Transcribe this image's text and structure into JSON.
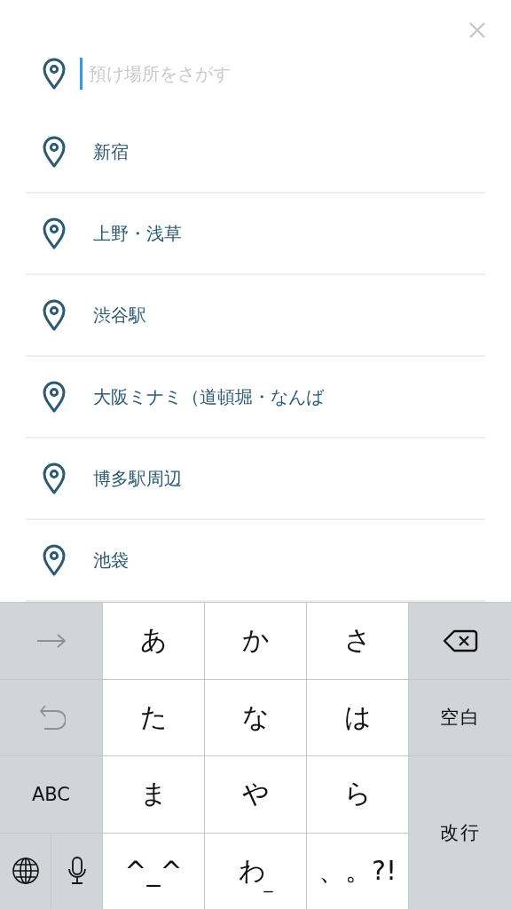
{
  "search": {
    "placeholder": "預け場所をさがす",
    "focused": true
  },
  "places": [
    {
      "name": "新宿"
    },
    {
      "name": "上野・浅草"
    },
    {
      "name": "渋谷駅"
    },
    {
      "name": "大阪ミナミ（道頓堀・なんば"
    },
    {
      "name": "博多駅周辺"
    },
    {
      "name": "池袋"
    }
  ],
  "keyboard": {
    "keys": [
      {
        "kind": "arrow"
      },
      {
        "kind": "char",
        "label": "あ"
      },
      {
        "kind": "char",
        "label": "か"
      },
      {
        "kind": "char",
        "label": "さ"
      },
      {
        "kind": "delete"
      },
      {
        "kind": "undo"
      },
      {
        "kind": "char",
        "label": "た"
      },
      {
        "kind": "char",
        "label": "な"
      },
      {
        "kind": "char",
        "label": "は"
      },
      {
        "kind": "func",
        "label": "空白"
      },
      {
        "kind": "mode",
        "label": "ABC"
      },
      {
        "kind": "char",
        "label": "ま"
      },
      {
        "kind": "char",
        "label": "や"
      },
      {
        "kind": "char",
        "label": "ら"
      },
      {
        "kind": "return",
        "label": "改行"
      },
      {
        "kind": "globe"
      },
      {
        "kind": "mic"
      },
      {
        "kind": "char",
        "label": "^_^"
      },
      {
        "kind": "char",
        "label": "わ",
        "sub": "_"
      },
      {
        "kind": "char",
        "label": "、。?!"
      }
    ]
  }
}
